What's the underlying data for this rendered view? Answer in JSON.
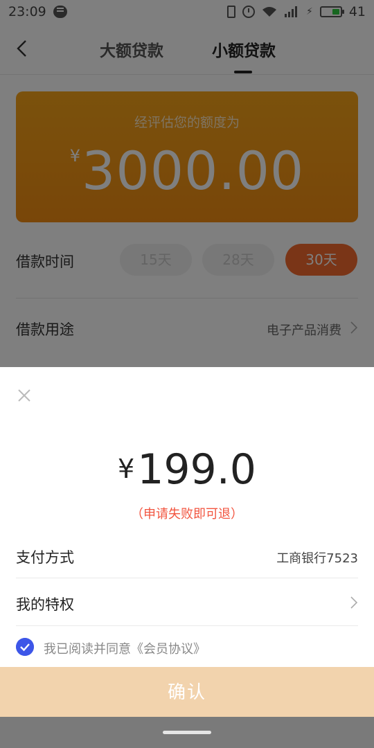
{
  "status_bar": {
    "time": "23:09",
    "battery_level": "41"
  },
  "header": {
    "tabs": [
      "大额贷款",
      "小额贷款"
    ],
    "active_tab": "小额贷款"
  },
  "credit_card": {
    "label": "经评估您的额度为",
    "currency": "¥",
    "amount": "3000.00"
  },
  "loan_term": {
    "label": "借款时间",
    "options": [
      "15天",
      "28天",
      "30天"
    ],
    "selected": "30天"
  },
  "loan_purpose": {
    "label": "借款用途",
    "value": "电子产品消费"
  },
  "payment_sheet": {
    "currency": "¥",
    "amount": "199.0",
    "refund_note": "（申请失败即可退）",
    "pay_method_label": "支付方式",
    "pay_method_value": "工商银行7523",
    "privilege_label": "我的特权",
    "agreement_text": "我已阅读并同意《会员协议》",
    "agreement_checked": true,
    "confirm_label": "确认"
  },
  "colors": {
    "card_orange": "#f59e18",
    "selected_term": "#f56a2e",
    "refund_red": "#f2543f",
    "checkbox_blue": "#3d56e8",
    "confirm_disabled": "#f2d3ad"
  }
}
